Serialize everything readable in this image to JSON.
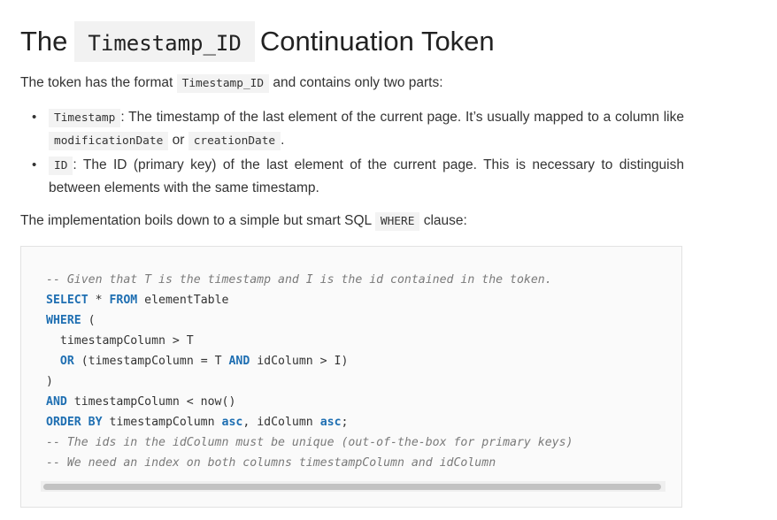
{
  "heading": {
    "prefix": "The",
    "code": "Timestamp_ID",
    "suffix": "Continuation Token"
  },
  "intro": {
    "before": "The token has the format ",
    "code": "Timestamp_ID",
    "after": " and contains only two parts:"
  },
  "bullets": [
    {
      "code": "Timestamp",
      "text_before": ": The timestamp of the last element of the current page. It’s usually mapped to a column like ",
      "code2": "modificationDate",
      "text_mid": " or ",
      "code3": "creationDate",
      "text_after": "."
    },
    {
      "code": "ID",
      "text": ": The ID (primary key) of the last element of the current page. This is necessary to distinguish between elements with the same timestamp."
    }
  ],
  "impl": {
    "before": "The implementation boils down to a simple but smart SQL ",
    "code": "WHERE",
    "after": " clause:"
  },
  "code_lines": {
    "l1": "-- Given that T is the timestamp and I is the id contained in the token.",
    "l2_kw1": "SELECT",
    "l2_mid": " * ",
    "l2_kw2": "FROM",
    "l2_rest": " elementTable",
    "l3_kw": "WHERE",
    "l3_rest": " (",
    "l4": "  timestampColumn > T",
    "l5_kw1": "OR",
    "l5_mid": " (timestampColumn = T ",
    "l5_kw2": "AND",
    "l5_rest": " idColumn > I)",
    "l6": ")",
    "l7_kw": "AND",
    "l7_rest": " timestampColumn < now()",
    "l8_kw1": "ORDER BY",
    "l8_mid": " timestampColumn ",
    "l8_kw2": "asc",
    "l8_mid2": ", idColumn ",
    "l8_kw3": "asc",
    "l8_rest": ";",
    "l9": "-- The ids in the idColumn must be unique (out-of-the-box for primary keys)",
    "l10": "-- We need an index on both columns timestampColumn and idColumn"
  }
}
